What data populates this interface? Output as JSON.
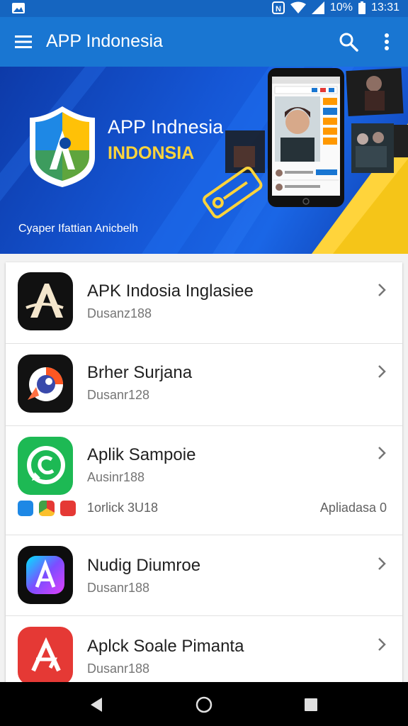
{
  "statusbar": {
    "battery": "10%",
    "time": "13:31"
  },
  "appbar": {
    "title": "APP Indonesia"
  },
  "banner": {
    "title": "APP Indnesia",
    "subtitle": "INDONSIA",
    "caption": "Cyaper Ifattian Anicbelh"
  },
  "apps": [
    {
      "name": "APK Indosia Inglasiee",
      "sub": "Dusanz188"
    },
    {
      "name": "Brher Surjana",
      "sub": "Dusanr128"
    },
    {
      "name": "Aplik Sampoie",
      "sub": "Ausinr188",
      "extra_left": "1orlick 3U18",
      "extra_right": "Apliadasa 0"
    },
    {
      "name": "Nudig Diumroe",
      "sub": "Dusanr188"
    },
    {
      "name": "Aplck Soale Pimanta",
      "sub": "Dusanr188"
    }
  ],
  "colors": {
    "appbar": "#1976d2",
    "statusbar": "#1565c0",
    "accent_yellow": "#ffd43b"
  }
}
